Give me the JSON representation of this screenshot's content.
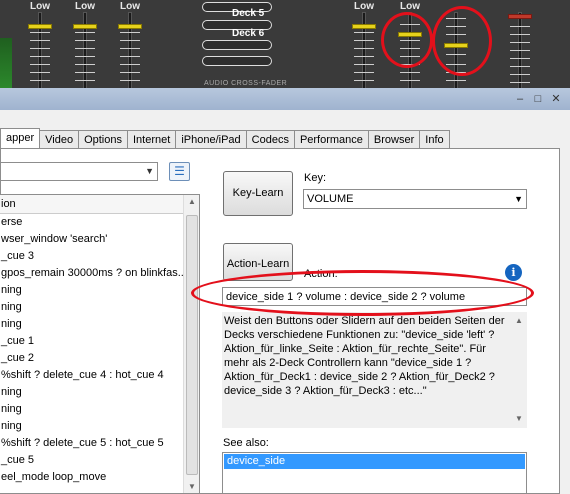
{
  "mixer": {
    "low_labels": [
      "Low",
      "Low",
      "Low",
      "Low",
      "Low"
    ],
    "deck5": "Deck 5",
    "deck6": "Deck 6",
    "crossfader": "AUDIO CROSS-FADER",
    "colors": {
      "knob": "#e6d21c",
      "annotation": "#e3101b",
      "meter": "#2c8a2c"
    }
  },
  "window": {
    "controls": {
      "minimize": "–",
      "maximize": "□",
      "close": "✕"
    }
  },
  "tabs": [
    "apper",
    "Video",
    "Options",
    "Internet",
    "iPhone/iPad",
    "Codecs",
    "Performance",
    "Browser",
    "Info"
  ],
  "left": {
    "combo_value": "",
    "list_header": "ion",
    "items": [
      "erse",
      "wser_window 'search'",
      "_cue 3",
      "gpos_remain 30000ms ? on blinkfas...",
      "ning",
      "ning",
      "ning",
      "_cue 1",
      "_cue 2",
      "%shift ? delete_cue 4 : hot_cue 4",
      "ning",
      "ning",
      "ning",
      "%shift ? delete_cue 5 : hot_cue 5",
      "_cue 5",
      "eel_mode loop_move"
    ]
  },
  "right": {
    "key_learn": "Key-Learn",
    "key_label": "Key:",
    "key_value": "VOLUME",
    "action_learn": "Action-Learn",
    "action_label": "Action:",
    "action_value": "device_side 1 ? volume  : device_side 2 ? volume",
    "description": "Weist den Buttons oder Slidern auf den beiden Seiten der Decks verschiedene Funktionen zu: \"device_side 'left' ? Aktion_für_linke_Seite : Aktion_für_rechte_Seite\". Für mehr als 2-Deck Controllern kann \"device_side 1 ? Aktion_für_Deck1 : device_side 2 ? Aktion_für_Deck2 ? device_side 3 ? Aktion_für_Deck3 : etc...\"",
    "see_also_label": "See also:",
    "see_also_items": [
      "device_side"
    ]
  },
  "icons": {
    "info": "info-icon",
    "list": "list-view-icon"
  }
}
